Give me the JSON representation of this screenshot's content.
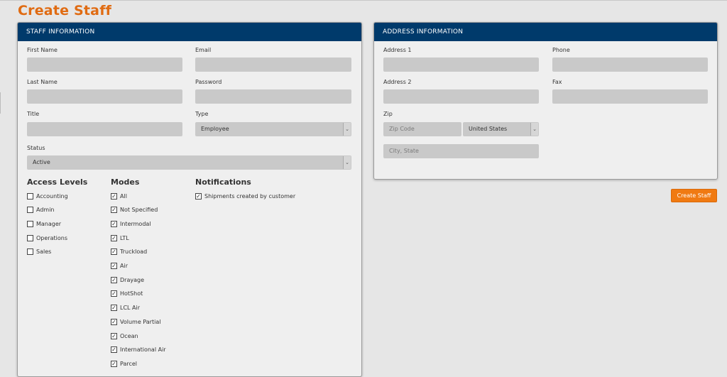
{
  "page": {
    "title": "Create Staff"
  },
  "staff_panel": {
    "header": "STAFF INFORMATION",
    "first_name": {
      "label": "First Name",
      "value": ""
    },
    "email": {
      "label": "Email",
      "value": ""
    },
    "last_name": {
      "label": "Last Name",
      "value": ""
    },
    "password": {
      "label": "Password",
      "value": ""
    },
    "title_field": {
      "label": "Title",
      "value": ""
    },
    "type": {
      "label": "Type",
      "value": "Employee"
    },
    "status": {
      "label": "Status",
      "value": "Active"
    }
  },
  "access_levels": {
    "title": "Access Levels",
    "items": [
      {
        "label": "Accounting",
        "checked": false
      },
      {
        "label": "Admin",
        "checked": false
      },
      {
        "label": "Manager",
        "checked": false
      },
      {
        "label": "Operations",
        "checked": false
      },
      {
        "label": "Sales",
        "checked": false
      }
    ]
  },
  "modes": {
    "title": "Modes",
    "items": [
      {
        "label": "All",
        "checked": true
      },
      {
        "label": "Not Specified",
        "checked": true
      },
      {
        "label": "Intermodal",
        "checked": true
      },
      {
        "label": "LTL",
        "checked": true
      },
      {
        "label": "Truckload",
        "checked": true
      },
      {
        "label": "Air",
        "checked": true
      },
      {
        "label": "Drayage",
        "checked": true
      },
      {
        "label": "HotShot",
        "checked": true
      },
      {
        "label": "LCL Air",
        "checked": true
      },
      {
        "label": "Volume Partial",
        "checked": true
      },
      {
        "label": "Ocean",
        "checked": true
      },
      {
        "label": "International Air",
        "checked": true
      },
      {
        "label": "Parcel",
        "checked": true
      }
    ]
  },
  "notifications": {
    "title": "Notifications",
    "items": [
      {
        "label": "Shipments created by customer",
        "checked": true
      }
    ]
  },
  "address_panel": {
    "header": "ADDRESS INFORMATION",
    "address1": {
      "label": "Address 1",
      "value": ""
    },
    "phone": {
      "label": "Phone",
      "value": ""
    },
    "address2": {
      "label": "Address 2",
      "value": ""
    },
    "fax": {
      "label": "Fax",
      "value": ""
    },
    "zip": {
      "label": "Zip",
      "placeholder": "Zip Code",
      "country": "United States"
    },
    "city_state": {
      "placeholder": "City, State"
    }
  },
  "actions": {
    "create_label": "Create Staff"
  },
  "colors": {
    "accent": "#e06b12",
    "header_bg": "#003a6b",
    "button_bg": "#f07a12"
  }
}
